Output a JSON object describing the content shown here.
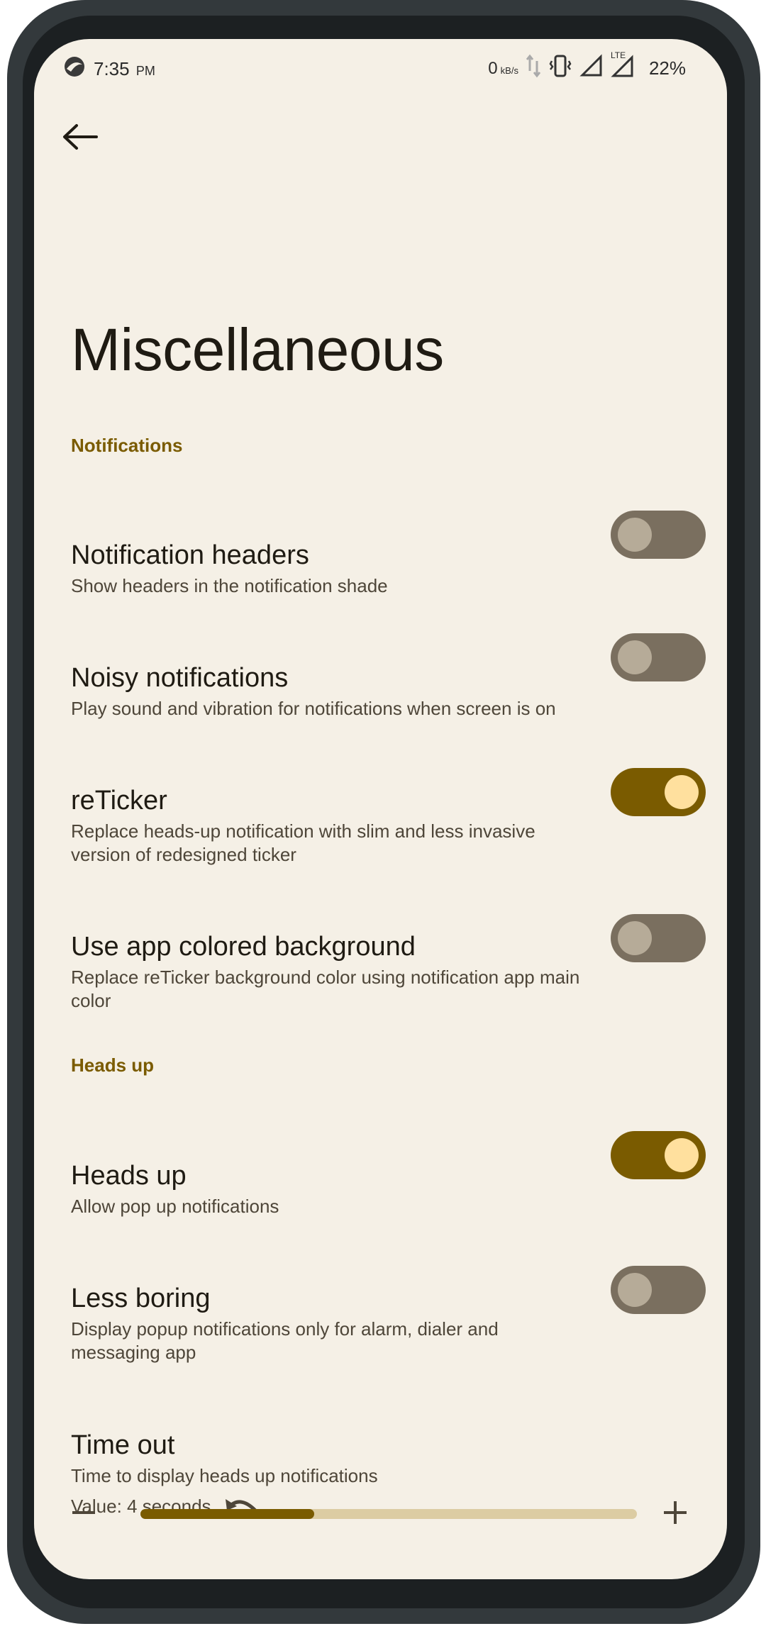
{
  "status_bar": {
    "time": "7:35",
    "ampm": "PM",
    "net_speed": "0",
    "net_unit": "kB/s",
    "lte": "LTE",
    "battery": "22%"
  },
  "page": {
    "title": "Miscellaneous"
  },
  "sections": {
    "notifications": "Notifications",
    "heads_up": "Heads up"
  },
  "items": {
    "notification_headers": {
      "title": "Notification headers",
      "subtitle": "Show headers in the notification shade",
      "enabled": false
    },
    "noisy_notifications": {
      "title": "Noisy notifications",
      "subtitle": "Play sound and vibration for notifications when screen is on",
      "enabled": false
    },
    "reticker": {
      "title": "reTicker",
      "subtitle": "Replace heads-up notification with slim and less invasive version of redesigned ticker",
      "enabled": true
    },
    "app_colored_bg": {
      "title": "Use app colored background",
      "subtitle": "Replace reTicker background color using notification app main color",
      "enabled": false
    },
    "heads_up": {
      "title": "Heads up",
      "subtitle": "Allow pop up notifications",
      "enabled": true
    },
    "less_boring": {
      "title": "Less boring",
      "subtitle": "Display popup notifications only for alarm, dialer and messaging app",
      "enabled": false
    },
    "time_out": {
      "title": "Time out",
      "subtitle": "Time to display heads up notifications",
      "value_text": "Value: 4 seconds",
      "slider_fraction": 0.35
    }
  },
  "colors": {
    "accent": "#7a5b00",
    "background": "#f5f0e6",
    "switch_off": "#7a6f5f"
  },
  "icons": {
    "back": "arrow-left-icon",
    "reset": "undo-icon",
    "decrease": "minus-icon",
    "increase": "plus-icon"
  }
}
